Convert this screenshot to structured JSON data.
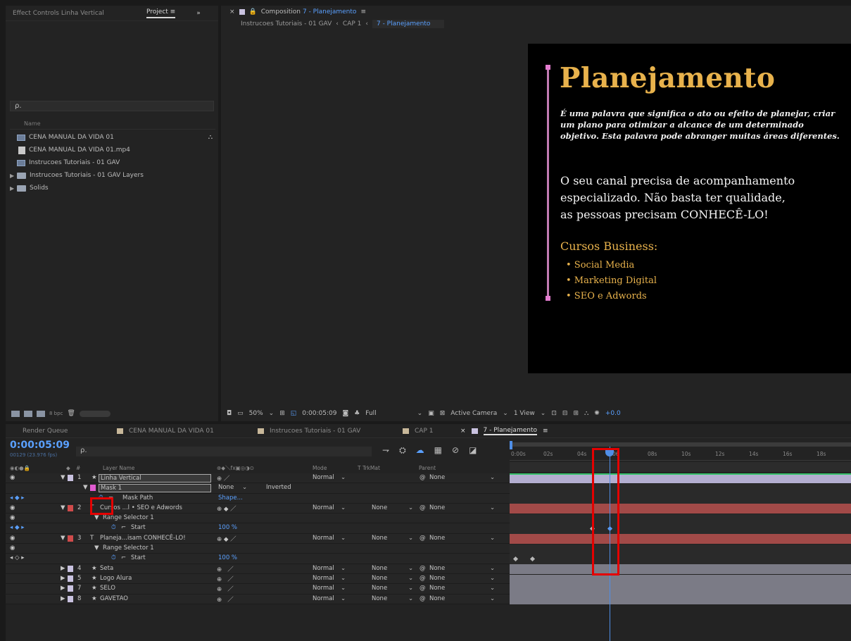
{
  "project_panel": {
    "tab_effect_controls": "Effect Controls Linha Vertical",
    "tab_project": "Project",
    "tab_menu": "≡",
    "expand_arrows": "»",
    "search_placeholder": "ρ.",
    "column_name": "Name",
    "items": [
      {
        "name": "CENA MANUAL DA VIDA 01",
        "type": "comp",
        "expandable": false
      },
      {
        "name": "CENA MANUAL DA VIDA 01.mp4",
        "type": "file",
        "expandable": false
      },
      {
        "name": "Instrucoes Tutoriais - 01 GAV",
        "type": "comp",
        "expandable": false
      },
      {
        "name": "Instrucoes Tutoriais - 01 GAV Layers",
        "type": "folder",
        "expandable": true
      },
      {
        "name": "Solids",
        "type": "folder",
        "expandable": true
      }
    ],
    "footer_bpc": "8 bpc"
  },
  "composition": {
    "tab_label": "Composition",
    "tab_comp_name": "7 - Planejamento",
    "tab_menu": "≡",
    "breadcrumbs": [
      "Instrucoes Tutoriais - 01 GAV",
      "CAP 1",
      "7 - Planejamento"
    ],
    "canvas": {
      "title": "Planejamento",
      "italic_text": "É uma palavra que significa o ato ou efeito de planejar, criar um plano para otimizar a alcance de um determinado objetivo. Esta palavra pode abranger muitas áreas diferentes.",
      "body_lines": [
        "O seu canal precisa de acompanhamento",
        "especializado. Não basta ter qualidade,",
        "as pessoas precisam CONHECÊ-LO!"
      ],
      "subtitle": "Cursos Business:",
      "bullets": [
        "• Social Media",
        "• Marketing Digital",
        "•  SEO e Adwords"
      ]
    },
    "toolbar": {
      "zoom": "50%",
      "timecode": "0:00:05:09",
      "resolution": "Full",
      "camera": "Active Camera",
      "view": "1 View",
      "exposure": "+0.0"
    }
  },
  "timeline": {
    "tabs": [
      {
        "label": "Render Queue",
        "active": false
      },
      {
        "label": "CENA MANUAL DA VIDA 01",
        "active": false
      },
      {
        "label": "Instrucoes Tutoriais - 01 GAV",
        "active": false
      },
      {
        "label": "CAP 1",
        "active": false
      },
      {
        "label": "7 - Planejamento",
        "active": true
      }
    ],
    "tab_menu": "≡",
    "current_time": "0:00:05:09",
    "fps": "00129 (23.976 fps)",
    "search_placeholder": "ρ.",
    "columns": {
      "layer_name": "Layer Name",
      "mode": "Mode",
      "trkmat": "T  TrkMat",
      "parent": "Parent",
      "num": "#"
    },
    "ruler": [
      "0:00s",
      "02s",
      "04s",
      "06",
      "08s",
      "10s",
      "12s",
      "14s",
      "16s",
      "18s"
    ],
    "rows": [
      {
        "kind": "layer",
        "num": "1",
        "name": "Linha Vertical",
        "mode": "Normal",
        "trkmat": "",
        "parent": "None",
        "color": "#c9c2e0",
        "selected": true
      },
      {
        "kind": "mask",
        "name": "Mask 1",
        "mode": "None",
        "inverted": "Inverted",
        "color": "#e05bd0"
      },
      {
        "kind": "prop",
        "name": "Mask Path",
        "value": "Shape..."
      },
      {
        "kind": "layer",
        "num": "2",
        "name": "Cursos ...l  • SEO e Adwords",
        "mode": "Normal",
        "trkmat": "None",
        "parent": "None",
        "color": "#d04b4b"
      },
      {
        "kind": "group",
        "name": "Range Selector 1"
      },
      {
        "kind": "prop",
        "name": "Start",
        "value": "100 %"
      },
      {
        "kind": "layer",
        "num": "3",
        "name": "Planeja...isam CONHECÊ-LO!",
        "mode": "Normal",
        "trkmat": "None",
        "parent": "None",
        "color": "#d04b4b"
      },
      {
        "kind": "group",
        "name": "Range Selector 1"
      },
      {
        "kind": "prop",
        "name": "Start",
        "value": "100 %"
      },
      {
        "kind": "layer",
        "num": "4",
        "name": "Seta",
        "mode": "Normal",
        "trkmat": "None",
        "parent": "None",
        "color": "#c9c2e0"
      },
      {
        "kind": "layer",
        "num": "5",
        "name": "Logo Alura",
        "mode": "Normal",
        "trkmat": "None",
        "parent": "None",
        "color": "#c9c2e0"
      },
      {
        "kind": "layer",
        "num": "7",
        "name": "SELO",
        "mode": "Normal",
        "trkmat": "None",
        "parent": "None",
        "color": "#c9c2e0"
      },
      {
        "kind": "layer",
        "num": "8",
        "name": "GAVETAO",
        "mode": "Normal",
        "trkmat": "None",
        "parent": "None",
        "color": "#c9c2e0"
      }
    ]
  },
  "colors": {
    "accent": "#5aa0ff",
    "title_gold": "#e8b24c",
    "line_pink": "#c27bb3",
    "highlight_red": "#e40000",
    "bar_lavender": "#b3aed0",
    "bar_red": "#a24a48",
    "bar_gray": "#7b7b86"
  }
}
